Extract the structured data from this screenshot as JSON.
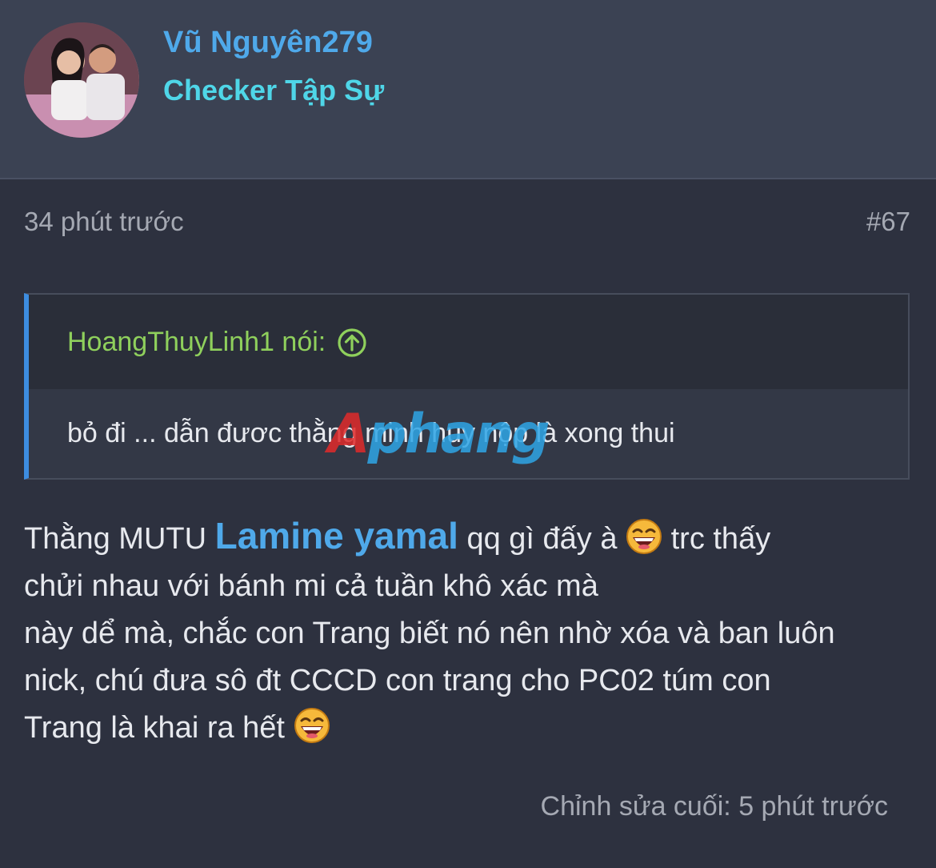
{
  "author": {
    "username": "Vũ Nguyên279",
    "title": "Checker Tập Sự"
  },
  "post": {
    "time": "34 phút trước",
    "number": "#67",
    "quote": {
      "author_label": "HoangThuyLinh1 nói:",
      "text": "bỏ đi ... dẫn đươc thằng minh huy nộp là xong thui"
    },
    "body": {
      "part1": "Thằng MUTU ",
      "mention": "Lamine yamal",
      "part2": " qq gì đấy à ",
      "part3": " trc thấy",
      "line2": "chửi nhau với bánh mi cả tuần khô xác mà",
      "line3": "này dể mà, chắc con Trang biết nó nên nhờ xóa và ban luôn",
      "line4": "nick, chú đưa sô đt CCCD con trang cho PC02 túm con",
      "line5": "Trang là khai ra hết "
    },
    "edited": "Chỉnh sửa cuối: 5 phút trước"
  },
  "watermark": {
    "first_letter": "A",
    "rest": "phang"
  },
  "icons": {
    "jump": "arrow-up-circle-icon",
    "emoji": "laughing-emoji-icon"
  },
  "colors": {
    "background": "#2d313f",
    "header": "#3b4253",
    "link": "#4fa9ea",
    "title": "#4fd6e8",
    "quote_author": "#8fd05c"
  }
}
